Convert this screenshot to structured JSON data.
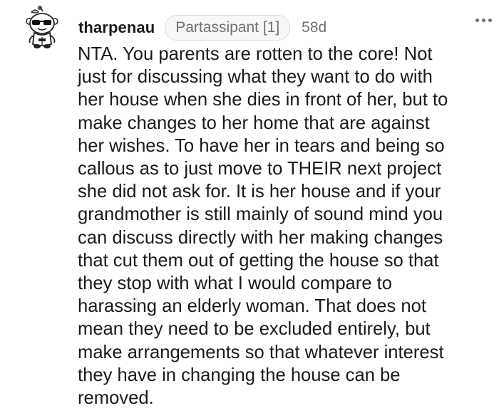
{
  "comment": {
    "username": "tharpenau",
    "flair": "Partassipant [1]",
    "age": "58d",
    "avatar_icon": "snoo-avatar-with-sunglasses-icon",
    "more_icon": "more-options-icon",
    "body_lines": [
      "NTA. You parents are rotten to the core! Not",
      "just for discussing what they want to do with",
      "her house when she dies in front of her, but to",
      "make changes to her home that are against",
      "her wishes. To have her in tears and being so",
      "callous as to just move to THEIR next project",
      "she did not ask for. It is her house and if your",
      "grandmother is still mainly of sound mind you",
      "can discuss directly with her making changes",
      "that cut them out of getting the house so that",
      "they stop with what I would compare to",
      "harassing an elderly woman. That does not",
      "mean they need to be excluded entirely, but",
      "make arrangements so that whatever interest",
      "they have in changing the house can be",
      "removed."
    ]
  }
}
